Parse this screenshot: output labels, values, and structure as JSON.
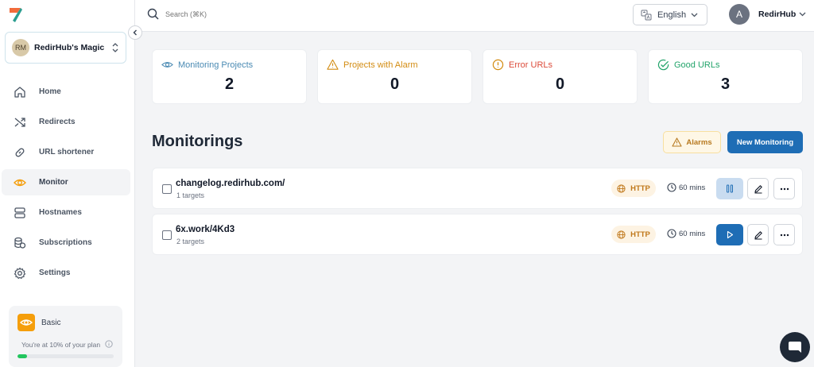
{
  "sidebar": {
    "workspace": {
      "initials": "RM",
      "name": "RedirHub's Magic"
    },
    "items": [
      {
        "label": "Home",
        "icon": "home-icon"
      },
      {
        "label": "Redirects",
        "icon": "shuffle-icon"
      },
      {
        "label": "URL shortener",
        "icon": "link-icon"
      },
      {
        "label": "Monitor",
        "icon": "eye-icon",
        "active": true
      },
      {
        "label": "Hostnames",
        "icon": "server-icon"
      },
      {
        "label": "Subscriptions",
        "icon": "coins-icon"
      },
      {
        "label": "Settings",
        "icon": "gear-icon"
      }
    ],
    "plan": {
      "name": "Basic",
      "usage_text": "You're at 10% of your plan",
      "usage_fraction": 0.1
    }
  },
  "topbar": {
    "search_placeholder": "Search (⌘K)",
    "language": "English",
    "user_initial": "A",
    "user_name": "RedirHub"
  },
  "stats": [
    {
      "label": "Monitoring Projects",
      "value": "2",
      "color": "#4a8ab3"
    },
    {
      "label": "Projects with Alarm",
      "value": "0",
      "color": "#d38c12"
    },
    {
      "label": "Error URLs",
      "value": "0",
      "color": "#dc4b3a"
    },
    {
      "label": "Good URLs",
      "value": "3",
      "color": "#23a46b"
    }
  ],
  "monitorings": {
    "title": "Monitorings",
    "alarms_label": "Alarms",
    "new_label": "New Monitoring",
    "rows": [
      {
        "url": "changelog.redirhub.com/",
        "targets": "1 targets",
        "protocol": "HTTP",
        "interval": "60 mins",
        "state": "running"
      },
      {
        "url": "6x.work/4Kd3",
        "targets": "2 targets",
        "protocol": "HTTP",
        "interval": "60 mins",
        "state": "paused"
      }
    ]
  },
  "colors": {
    "accent": "#1e6db5",
    "warning": "#f59e0b",
    "success": "#22c55e"
  }
}
